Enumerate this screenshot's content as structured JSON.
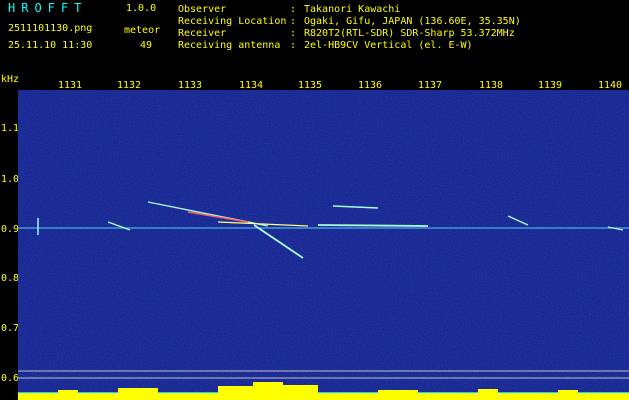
{
  "header": {
    "app_title": "HROFFT",
    "app_version": "1.0.0",
    "filename": "2511101130.png",
    "datetime": "25.11.10 11:30",
    "meteor_label": "meteor",
    "meteor_count": "49",
    "info": [
      {
        "key": "Observer",
        "value": "Takanori Kawachi"
      },
      {
        "key": "Receiving Location",
        "value": "Ogaki, Gifu, JAPAN (136.60E, 35.35N)"
      },
      {
        "key": "Receiver",
        "value": "R820T2(RTL-SDR) SDR-Sharp 53.372MHz"
      },
      {
        "key": "Receiving antenna",
        "value": "2el-HB9CV Vertical (el. E-W)"
      }
    ],
    "info_separator": ":"
  },
  "axes": {
    "y_unit": "kHz",
    "x_ticks": [
      "1131",
      "1132",
      "1133",
      "1134",
      "1135",
      "1136",
      "1137",
      "1138",
      "1139",
      "1140"
    ],
    "y_ticks": [
      "1.1",
      "1.0",
      "0.9",
      "0.8",
      "0.7",
      "0.6"
    ]
  },
  "colors": {
    "background": "#1a2aa8",
    "text_primary": "#ffff00",
    "text_secondary": "#00ffff",
    "signal_band": "#00e0ff",
    "noise_bar": "#ffff00"
  }
}
